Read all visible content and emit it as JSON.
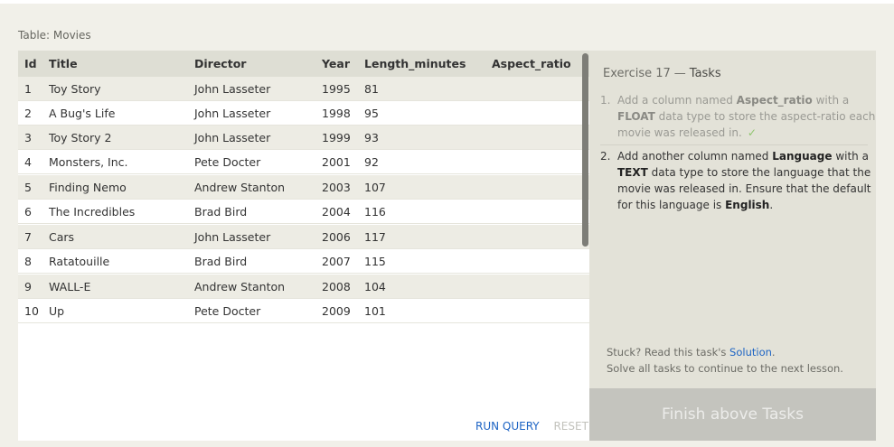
{
  "table_label": "Table: Movies",
  "columns": [
    "Id",
    "Title",
    "Director",
    "Year",
    "Length_minutes",
    "Aspect_ratio"
  ],
  "rows": [
    [
      "1",
      "Toy Story",
      "John Lasseter",
      "1995",
      "81",
      ""
    ],
    [
      "2",
      "A Bug's Life",
      "John Lasseter",
      "1998",
      "95",
      ""
    ],
    [
      "3",
      "Toy Story 2",
      "John Lasseter",
      "1999",
      "93",
      ""
    ],
    [
      "4",
      "Monsters, Inc.",
      "Pete Docter",
      "2001",
      "92",
      ""
    ],
    [
      "5",
      "Finding Nemo",
      "Andrew Stanton",
      "2003",
      "107",
      ""
    ],
    [
      "6",
      "The Incredibles",
      "Brad Bird",
      "2004",
      "116",
      ""
    ],
    [
      "7",
      "Cars",
      "John Lasseter",
      "2006",
      "117",
      ""
    ],
    [
      "8",
      "Ratatouille",
      "Brad Bird",
      "2007",
      "115",
      ""
    ],
    [
      "9",
      "WALL-E",
      "Andrew Stanton",
      "2008",
      "104",
      ""
    ],
    [
      "10",
      "Up",
      "Pete Docter",
      "2009",
      "101",
      ""
    ]
  ],
  "actions": {
    "run_query": "RUN QUERY",
    "reset": "RESET"
  },
  "tasks_panel": {
    "title_prefix": "Exercise 17",
    "title_dash": "—",
    "title_suffix": "Tasks",
    "task1": {
      "number": "1.",
      "p1": "Add a column named ",
      "b1": "Aspect_ratio",
      "p2": " with a ",
      "b2": "FLOAT",
      "p3": " data type to store the aspect-ratio each movie was released in.",
      "check": "✓",
      "completed": true
    },
    "task2": {
      "number": "2.",
      "p1": "Add another column named ",
      "b1": "Language",
      "p2": " with a ",
      "b2": "TEXT",
      "p3": " data type to store the language that the movie was released in. Ensure that the default for this language is ",
      "b3": "English",
      "p4": ".",
      "completed": false
    },
    "stuck_prefix": "Stuck? Read this task's ",
    "solution_link": "Solution",
    "stuck_suffix": ".",
    "solve_all": "Solve all tasks to continue to the next lesson.",
    "finish_button": "Finish above Tasks"
  },
  "colors": {
    "accent_link": "#1d64c4",
    "check_green": "#8fc56e",
    "finish_disabled_bg": "#c4c4be"
  }
}
